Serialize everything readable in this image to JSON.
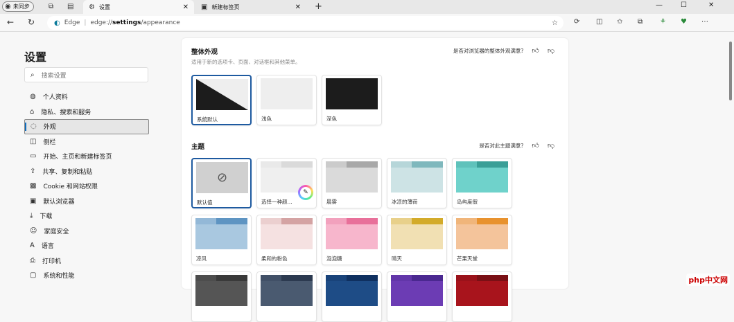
{
  "tabbar": {
    "profile": "未同步",
    "tabs": [
      {
        "title": "设置",
        "active": true
      },
      {
        "title": "新建标签页",
        "active": false
      }
    ]
  },
  "address": {
    "site": "Edge",
    "url_prefix": "edge://",
    "url_bold": "settings",
    "url_suffix": "/appearance"
  },
  "sidebar": {
    "title": "设置",
    "search_placeholder": "搜索设置",
    "items": [
      {
        "label": "个人资料",
        "icon": "profile-icon"
      },
      {
        "label": "隐私、搜索和服务",
        "icon": "lock-icon"
      },
      {
        "label": "外观",
        "icon": "palette-icon",
        "selected": true
      },
      {
        "label": "侧栏",
        "icon": "sidebar-icon"
      },
      {
        "label": "开始、主页和新建标签页",
        "icon": "home-icon"
      },
      {
        "label": "共享、复制和粘贴",
        "icon": "share-icon"
      },
      {
        "label": "Cookie 和网站权限",
        "icon": "cookie-icon"
      },
      {
        "label": "默认浏览器",
        "icon": "browser-icon"
      },
      {
        "label": "下载",
        "icon": "download-icon"
      },
      {
        "label": "家庭安全",
        "icon": "family-icon"
      },
      {
        "label": "语言",
        "icon": "language-icon"
      },
      {
        "label": "打印机",
        "icon": "printer-icon"
      },
      {
        "label": "系统和性能",
        "icon": "system-icon"
      }
    ]
  },
  "appearance": {
    "title": "整体外观",
    "subtitle": "适用于新的选项卡、页面、对话框和其他菜单。",
    "feedback": "是否对浏览器的整体外观满意?",
    "modes": [
      {
        "label": "系统默认",
        "selected": true
      },
      {
        "label": "浅色"
      },
      {
        "label": "深色"
      }
    ]
  },
  "themes": {
    "title": "主题",
    "feedback": "是否对此主题满意?",
    "items": [
      {
        "label": "默认值",
        "selected": true,
        "bar": "#d0d0d0",
        "body": "#d0d0d0"
      },
      {
        "label": "选择一种颜...",
        "bar": "#dadada",
        "body": "#efefef"
      },
      {
        "label": "晨雾",
        "bar": "#a8a8a8",
        "body": "#dadada"
      },
      {
        "label": "冰凉的薄荷",
        "bar": "#7fb8bd",
        "body": "#cde3e5"
      },
      {
        "label": "岛屿度假",
        "bar": "#3a9f97",
        "body": "#6fd2cb"
      },
      {
        "label": "凉风",
        "bar": "#5e94c2",
        "body": "#a9c8e0"
      },
      {
        "label": "柔和的粉色",
        "bar": "#d4a3a3",
        "body": "#f5e1e1"
      },
      {
        "label": "泡泡糖",
        "bar": "#e8709a",
        "body": "#f7b6cc"
      },
      {
        "label": "晴天",
        "bar": "#d3ab2a",
        "body": "#f1e0b3"
      },
      {
        "label": "芒果天堂",
        "bar": "#e8922e",
        "body": "#f4c49b"
      },
      {
        "label": "",
        "bar": "#3a3a3a",
        "body": "#555555"
      },
      {
        "label": "",
        "bar": "#2c3a50",
        "body": "#4a5a70"
      },
      {
        "label": "",
        "bar": "#0f3060",
        "body": "#1e4c86"
      },
      {
        "label": "",
        "bar": "#4a2890",
        "body": "#6c3cb4"
      },
      {
        "label": "",
        "bar": "#7a1015",
        "body": "#a8141c"
      }
    ]
  },
  "watermark": "php中文网"
}
